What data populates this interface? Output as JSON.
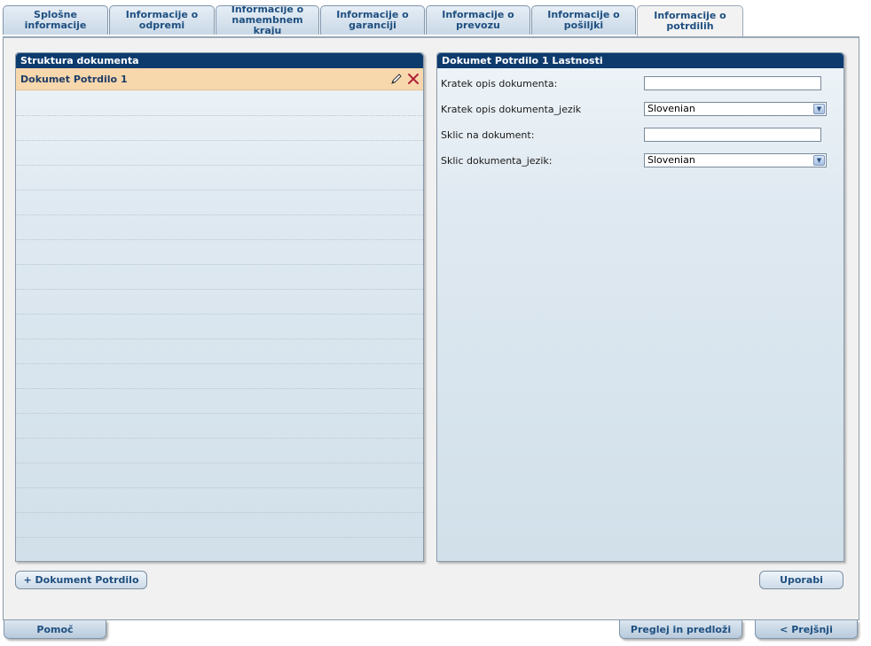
{
  "tabs": [
    {
      "label": "Splošne informacije"
    },
    {
      "label": "Informacije o odpremi"
    },
    {
      "label": "Informacije o namembnem kraju"
    },
    {
      "label": "Informacije o garanciji"
    },
    {
      "label": "Informacije o prevozu"
    },
    {
      "label": "Informacije o pošiljki"
    },
    {
      "label": "Informacije o potrdilih"
    }
  ],
  "left_panel": {
    "title": "Struktura dokumenta",
    "items": [
      {
        "label": "Dokumet Potrdilo 1"
      }
    ]
  },
  "right_panel": {
    "title": "Dokumet Potrdilo 1 Lastnosti",
    "fields": [
      {
        "label": "Kratek opis dokumenta:",
        "value": ""
      },
      {
        "label": "Kratek opis dokumenta_jezik",
        "value": "Slovenian"
      },
      {
        "label": "Sklic na dokument:",
        "value": ""
      },
      {
        "label": "Sklic dokumenta_jezik:",
        "value": "Slovenian"
      }
    ]
  },
  "buttons": {
    "add": "+ Dokument Potrdilo",
    "apply": "Uporabi"
  },
  "bottom": {
    "help": "Pomoč",
    "review": "Preglej in predloži",
    "previous": "< Prejšnji"
  },
  "colors": {
    "header_bg": "#0d3b6e",
    "selected_row": "#f7d7ac",
    "delete_icon": "#b0223a"
  }
}
